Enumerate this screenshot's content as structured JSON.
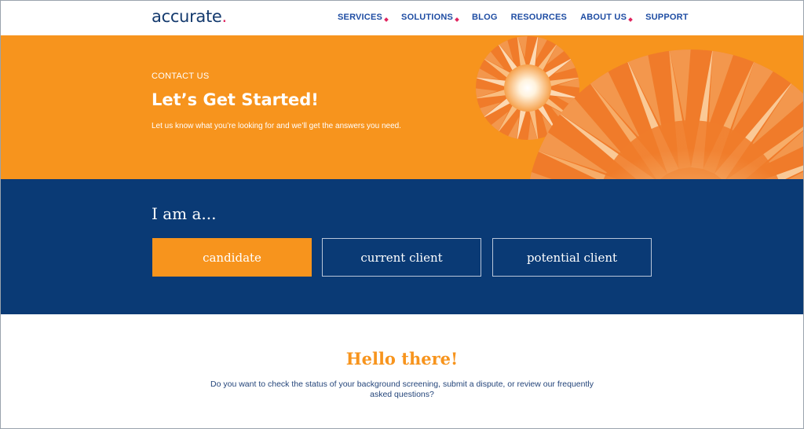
{
  "header": {
    "logo_text": "accurate",
    "logo_dot": ".",
    "nav": [
      {
        "label": "SERVICES",
        "dropdown": true
      },
      {
        "label": "SOLUTIONS",
        "dropdown": true
      },
      {
        "label": "BLOG",
        "dropdown": false
      },
      {
        "label": "RESOURCES",
        "dropdown": false
      },
      {
        "label": "ABOUT US",
        "dropdown": true
      },
      {
        "label": "SUPPORT",
        "dropdown": false
      }
    ]
  },
  "hero": {
    "eyebrow": "CONTACT US",
    "title": "Let’s Get Started!",
    "subtitle": "Let us know what you’re looking for and we’ll get the answers you need."
  },
  "selector": {
    "heading": "I am a...",
    "options": [
      {
        "label": "candidate",
        "selected": true
      },
      {
        "label": "current client",
        "selected": false
      },
      {
        "label": "potential client",
        "selected": false
      }
    ]
  },
  "hello": {
    "title": "Hello there!",
    "text": "Do you want to check the status of your background screening, submit a dispute, or review our frequently asked questions?"
  },
  "colors": {
    "brand_orange": "#f7941d",
    "brand_navy": "#0a3a75",
    "link_blue": "#1f4da3",
    "accent_pink": "#e0245e"
  }
}
